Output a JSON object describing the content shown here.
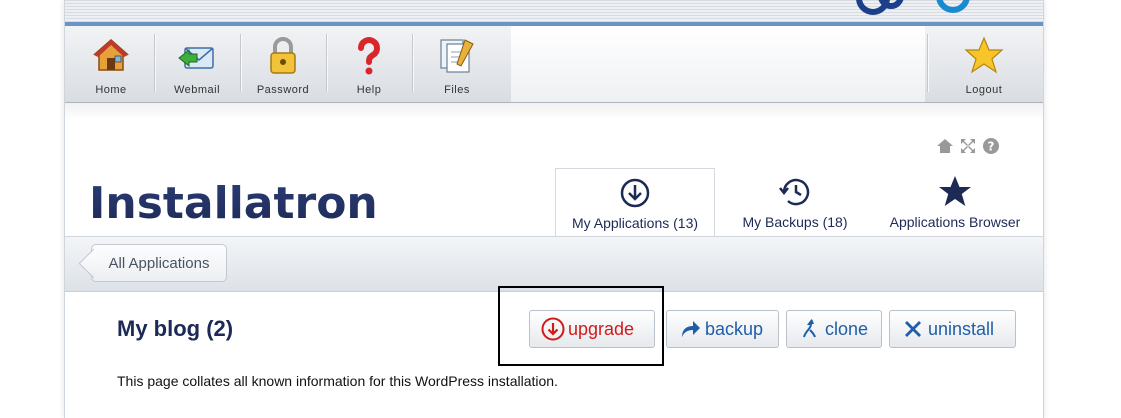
{
  "toolbar": {
    "items": [
      {
        "label": "Home"
      },
      {
        "label": "Webmail"
      },
      {
        "label": "Password"
      },
      {
        "label": "Help"
      },
      {
        "label": "Files"
      },
      {
        "label": "Logout"
      }
    ]
  },
  "brand": {
    "name": "Installatron"
  },
  "tabs": [
    {
      "label": "My Applications (13)",
      "active": true,
      "icon": "download-circle-icon"
    },
    {
      "label": "My Backups (18)",
      "active": false,
      "icon": "history-icon"
    },
    {
      "label": "Applications Browser",
      "active": false,
      "icon": "star-icon"
    }
  ],
  "breadcrumb": {
    "label": "All Applications"
  },
  "main": {
    "title": "My blog (2)",
    "description": "This page collates all known information for this WordPress installation.",
    "actions": [
      {
        "label": "upgrade",
        "icon": "upgrade-icon"
      },
      {
        "label": "backup",
        "icon": "share-arrow-icon"
      },
      {
        "label": "clone",
        "icon": "fork-icon"
      },
      {
        "label": "uninstall",
        "icon": "x-icon"
      }
    ]
  },
  "colors": {
    "brand": "#1d2a55",
    "accent_blue": "#1f5ea8",
    "upgrade_red": "#d11a1a",
    "top_line": "#6b93c3"
  }
}
